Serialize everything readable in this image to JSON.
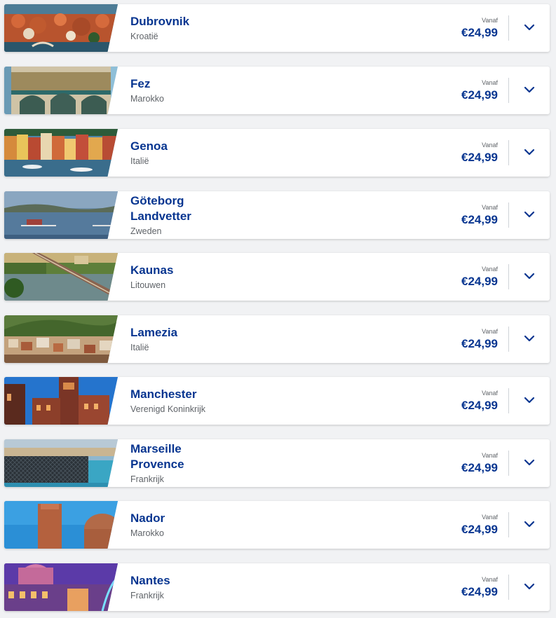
{
  "destinations": [
    {
      "city": "Dubrovnik",
      "country": "Kroatië",
      "from_label": "Vanaf",
      "price": "€24,99",
      "image": "dubrovnik-photo"
    },
    {
      "city": "Fez",
      "country": "Marokko",
      "from_label": "Vanaf",
      "price": "€24,99",
      "image": "fez-photo"
    },
    {
      "city": "Genoa",
      "country": "Italië",
      "from_label": "Vanaf",
      "price": "€24,99",
      "image": "genoa-photo"
    },
    {
      "city": "Göteborg Landvetter",
      "country": "Zweden",
      "from_label": "Vanaf",
      "price": "€24,99",
      "image": "goteborg-photo"
    },
    {
      "city": "Kaunas",
      "country": "Litouwen",
      "from_label": "Vanaf",
      "price": "€24,99",
      "image": "kaunas-photo"
    },
    {
      "city": "Lamezia",
      "country": "Italië",
      "from_label": "Vanaf",
      "price": "€24,99",
      "image": "lamezia-photo"
    },
    {
      "city": "Manchester",
      "country": "Verenigd Koninkrijk",
      "from_label": "Vanaf",
      "price": "€24,99",
      "image": "manchester-photo"
    },
    {
      "city": "Marseille Provence",
      "country": "Frankrijk",
      "from_label": "Vanaf",
      "price": "€24,99",
      "image": "marseille-photo"
    },
    {
      "city": "Nador",
      "country": "Marokko",
      "from_label": "Vanaf",
      "price": "€24,99",
      "image": "nador-photo"
    },
    {
      "city": "Nantes",
      "country": "Frankrijk",
      "from_label": "Vanaf",
      "price": "€24,99",
      "image": "nantes-photo"
    }
  ],
  "icons": {
    "expand": "chevron-down-icon"
  },
  "colors": {
    "brand_blue": "#073590",
    "text_grey": "#5f6368",
    "background": "#f1f2f4"
  }
}
